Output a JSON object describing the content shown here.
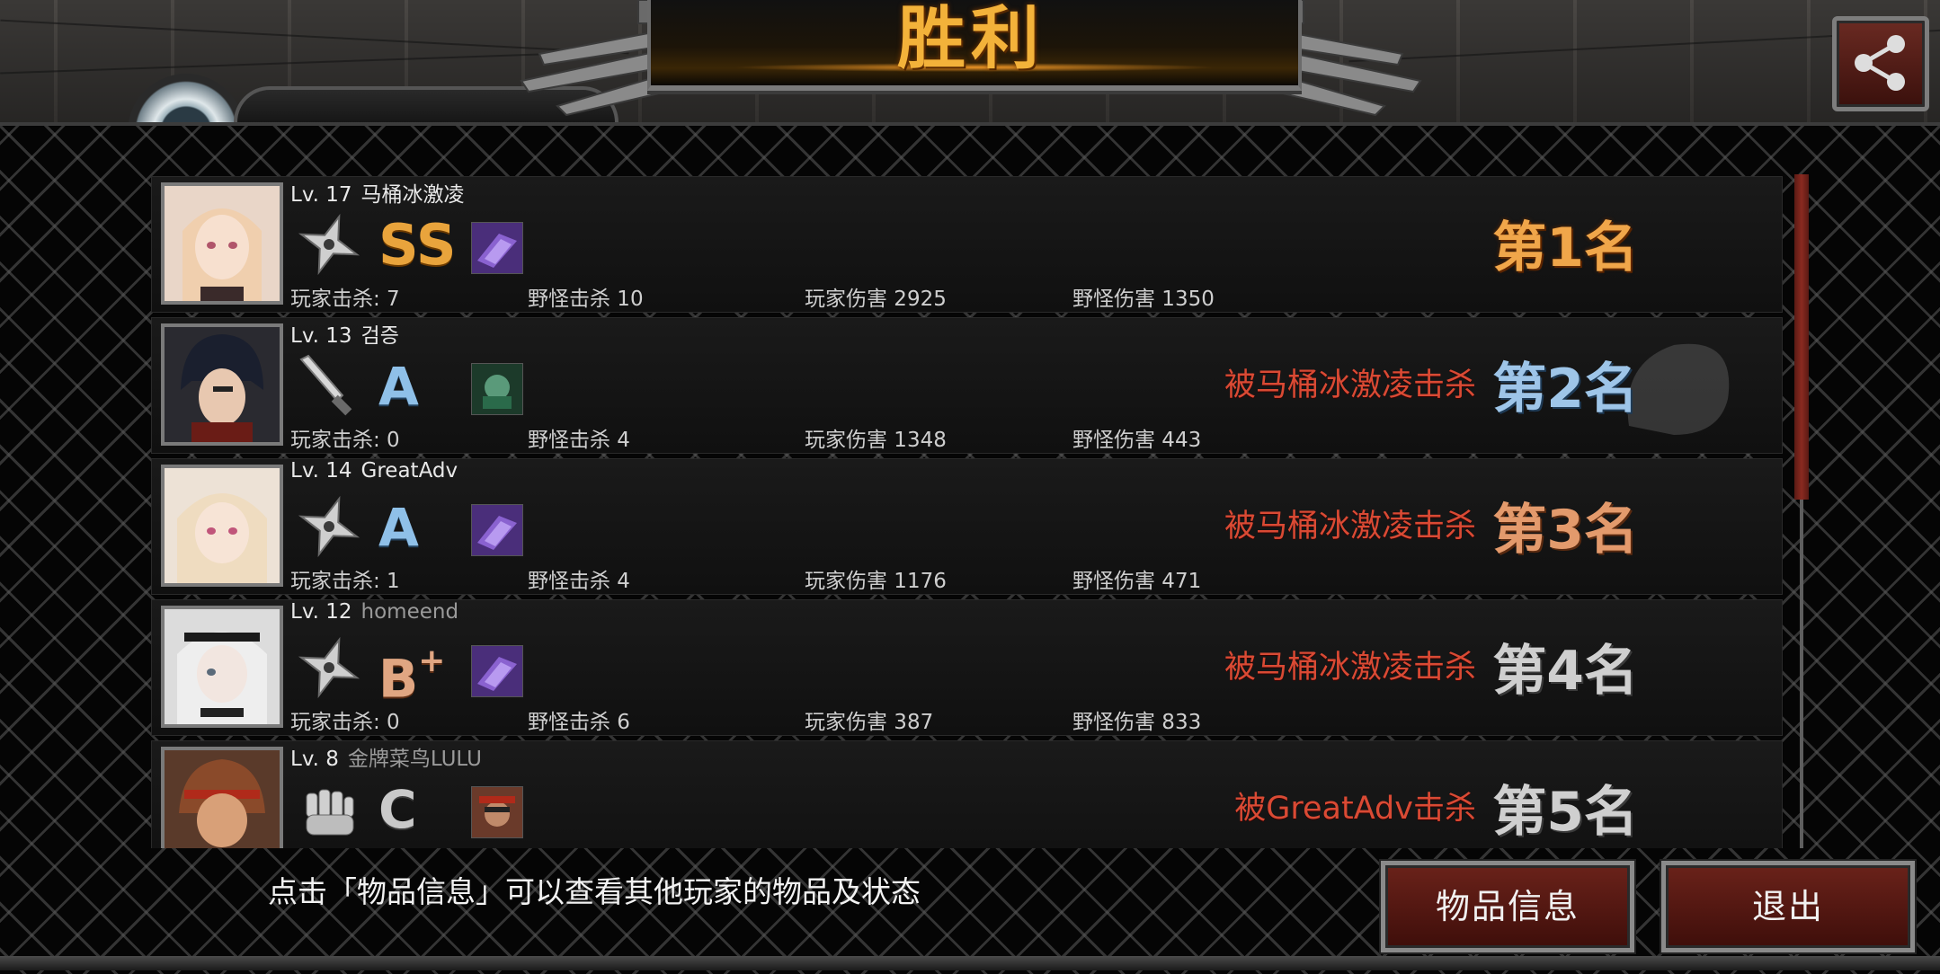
{
  "header": {
    "title": "胜利",
    "share_icon": "share-icon"
  },
  "players": [
    {
      "level": "Lv. 17",
      "name": "马桶冰激凌",
      "weapon_icon": "shuriken-icon",
      "grade": "SS",
      "grade_sup": "",
      "player_kills": "玩家击杀: 7",
      "monster_kills": "野怪击杀 10",
      "player_damage": "玩家伤害 2925",
      "monster_damage": "野怪伤害 1350",
      "killed_by": "",
      "rank": "第1名"
    },
    {
      "level": "Lv. 13",
      "name": "검증",
      "weapon_icon": "knife-icon",
      "grade": "A",
      "grade_sup": "",
      "player_kills": "玩家击杀: 0",
      "monster_kills": "野怪击杀 4",
      "player_damage": "玩家伤害 1348",
      "monster_damage": "野怪伤害 443",
      "killed_by": "被马桶冰激凌击杀",
      "rank": "第2名"
    },
    {
      "level": "Lv. 14",
      "name": "GreatAdv",
      "weapon_icon": "shuriken-icon",
      "grade": "A",
      "grade_sup": "",
      "player_kills": "玩家击杀: 1",
      "monster_kills": "野怪击杀 4",
      "player_damage": "玩家伤害 1176",
      "monster_damage": "野怪伤害 471",
      "killed_by": "被马桶冰激凌击杀",
      "rank": "第3名"
    },
    {
      "level": "Lv. 12",
      "name": "homeend",
      "weapon_icon": "shuriken-icon",
      "grade": "B",
      "grade_sup": "+",
      "player_kills": "玩家击杀: 0",
      "monster_kills": "野怪击杀 6",
      "player_damage": "玩家伤害 387",
      "monster_damage": "野怪伤害 833",
      "killed_by": "被马桶冰激凌击杀",
      "rank": "第4名"
    },
    {
      "level": "Lv. 8",
      "name": "金牌菜鸟LULU",
      "weapon_icon": "fist-icon",
      "grade": "C",
      "grade_sup": "",
      "player_kills": "",
      "monster_kills": "",
      "player_damage": "",
      "monster_damage": "",
      "killed_by": "被GreatAdv击杀",
      "rank": "第5名"
    }
  ],
  "footer": {
    "hint": "点击「物品信息」可以查看其他玩家的物品及状态",
    "info_button": "物品信息",
    "exit_button": "退出"
  },
  "colors": {
    "title_gold": "#f3b23a",
    "killed_red": "#d94a34",
    "button_red": "#6a221a"
  }
}
